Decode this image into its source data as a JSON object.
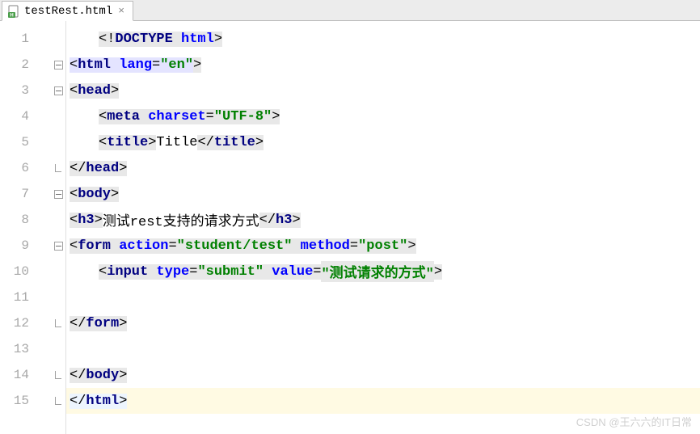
{
  "tab": {
    "filename": "testRest.html",
    "close_glyph": "×"
  },
  "watermark": "CSDN @王六六的IT日常",
  "lines": [
    {
      "n": 1,
      "fold": "",
      "tokens": [
        [
          "w1",
          ""
        ],
        [
          "p bg1",
          "<!"
        ],
        [
          "t bg1",
          "DOCTYPE "
        ],
        [
          "a bg1",
          "html"
        ],
        [
          "p bg1",
          ">"
        ]
      ]
    },
    {
      "n": 2,
      "fold": "minus",
      "tokens": [
        [
          "p bg3",
          "<"
        ],
        [
          "t bg3",
          "html "
        ],
        [
          "a bg3",
          "lang"
        ],
        [
          "p bg3",
          "="
        ],
        [
          "s bg3",
          "\"en\""
        ],
        [
          "p bg1",
          ">"
        ]
      ]
    },
    {
      "n": 3,
      "fold": "minus",
      "tokens": [
        [
          "p bg1",
          "<"
        ],
        [
          "t bg1",
          "head"
        ],
        [
          "p bg1",
          ">"
        ]
      ]
    },
    {
      "n": 4,
      "fold": "",
      "tokens": [
        [
          "w1",
          ""
        ],
        [
          "p bg1",
          "<"
        ],
        [
          "t bg1",
          "meta "
        ],
        [
          "a bg1",
          "charset"
        ],
        [
          "p bg1",
          "="
        ],
        [
          "s bg1",
          "\"UTF-8\""
        ],
        [
          "p bg1",
          ">"
        ]
      ]
    },
    {
      "n": 5,
      "fold": "",
      "tokens": [
        [
          "w1",
          ""
        ],
        [
          "p bg1",
          "<"
        ],
        [
          "t bg1",
          "title"
        ],
        [
          "p bg1",
          ">"
        ],
        [
          "tx",
          "Title"
        ],
        [
          "p bg1",
          "</"
        ],
        [
          "t bg1",
          "title"
        ],
        [
          "p bg1",
          ">"
        ]
      ]
    },
    {
      "n": 6,
      "fold": "end",
      "tokens": [
        [
          "p bg1",
          "</"
        ],
        [
          "t bg1",
          "head"
        ],
        [
          "p bg1",
          ">"
        ]
      ]
    },
    {
      "n": 7,
      "fold": "minus",
      "tokens": [
        [
          "p bg1",
          "<"
        ],
        [
          "t bg1",
          "body"
        ],
        [
          "p bg1",
          ">"
        ]
      ]
    },
    {
      "n": 8,
      "fold": "",
      "tokens": [
        [
          "p bg1",
          "<"
        ],
        [
          "t bg1",
          "h3"
        ],
        [
          "p bg1",
          ">"
        ],
        [
          "tx",
          "测试rest支持的请求方式"
        ],
        [
          "p bg1",
          "</"
        ],
        [
          "t bg1",
          "h3"
        ],
        [
          "p bg1",
          ">"
        ]
      ]
    },
    {
      "n": 9,
      "fold": "minus",
      "tokens": [
        [
          "p bg1",
          "<"
        ],
        [
          "t bg1",
          "form "
        ],
        [
          "a bg1",
          "action"
        ],
        [
          "p bg1",
          "="
        ],
        [
          "s bg1",
          "\"student/test\""
        ],
        [
          "t bg1",
          " "
        ],
        [
          "a bg1",
          "method"
        ],
        [
          "p bg1",
          "="
        ],
        [
          "s bg1",
          "\"post\""
        ],
        [
          "p bg1",
          ">"
        ]
      ]
    },
    {
      "n": 10,
      "fold": "",
      "tokens": [
        [
          "w1",
          ""
        ],
        [
          "p bg1",
          "<"
        ],
        [
          "t bg1",
          "input "
        ],
        [
          "a bg1",
          "type"
        ],
        [
          "p bg1",
          "="
        ],
        [
          "s bg1",
          "\"submit\""
        ],
        [
          "t bg1",
          " "
        ],
        [
          "a bg1",
          "value"
        ],
        [
          "p bg1",
          "="
        ],
        [
          "s bg1",
          "\"测试请求的方式\""
        ],
        [
          "p bg1",
          ">"
        ]
      ]
    },
    {
      "n": 11,
      "fold": "",
      "tokens": []
    },
    {
      "n": 12,
      "fold": "end",
      "tokens": [
        [
          "p bg1",
          "</"
        ],
        [
          "t bg1",
          "form"
        ],
        [
          "p bg1",
          ">"
        ]
      ]
    },
    {
      "n": 13,
      "fold": "",
      "tokens": []
    },
    {
      "n": 14,
      "fold": "end",
      "tokens": [
        [
          "p bg1",
          "</"
        ],
        [
          "t bg1",
          "body"
        ],
        [
          "p bg1",
          ">"
        ]
      ]
    },
    {
      "n": 15,
      "fold": "end",
      "hl": true,
      "tokens": [
        [
          "p bg2",
          "</"
        ],
        [
          "t bg2",
          "html"
        ],
        [
          "p bg2",
          ">"
        ]
      ]
    }
  ]
}
